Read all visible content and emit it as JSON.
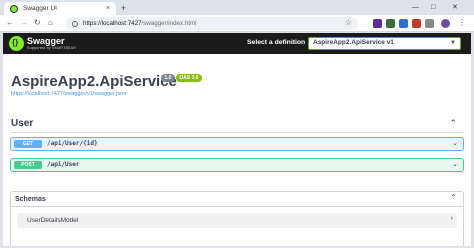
{
  "browser": {
    "tab_title": "Swagger UI",
    "url_host": "https://localhost:7427",
    "url_path": "/swagger/index.html",
    "new_tab": "+",
    "close_tab": "×"
  },
  "swagger": {
    "brand": "Swagger",
    "brand_sub": "Supported by SMARTBEAR",
    "select_label": "Select a definition",
    "selected_definition": "AspireApp2.ApiService v1",
    "title": "AspireApp2.ApiService",
    "version": "1.0",
    "oas": "OAS 3.0",
    "spec_link": "https://localhost:7427/swagger/v1/swagger.json"
  },
  "section": {
    "name": "User"
  },
  "operations": [
    {
      "method": "GET",
      "path": "/api/User/{id}"
    },
    {
      "method": "POST",
      "path": "/api/User"
    }
  ],
  "schemas": {
    "title": "Schemas",
    "models": [
      "UserDetailsModel"
    ]
  },
  "icons": {
    "accent_get": "#61affe",
    "accent_post": "#49cc90",
    "swagger_green": "#85ea2d"
  }
}
